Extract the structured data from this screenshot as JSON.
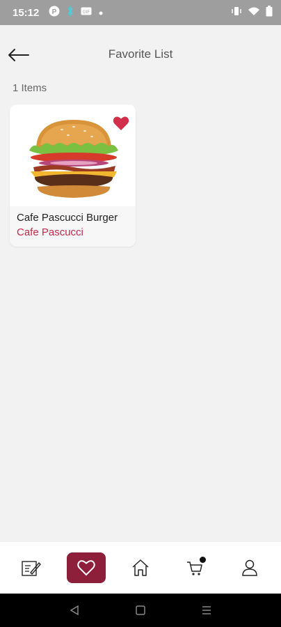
{
  "status_bar": {
    "time": "15:12",
    "icons": [
      "p-badge-icon",
      "bluetooth-icon",
      "gif-icon",
      "dot-icon",
      "vibrate-icon",
      "wifi-icon",
      "battery-icon"
    ]
  },
  "header": {
    "title": "Favorite List",
    "back_icon": "arrow-left-icon"
  },
  "favorites": {
    "count_label": "1 Items",
    "items": [
      {
        "name": "Cafe Pascucci Burger",
        "vendor": "Cafe Pascucci",
        "favorited": true
      }
    ]
  },
  "bottom_nav": {
    "items": [
      {
        "icon": "menu-edit-icon",
        "active": false
      },
      {
        "icon": "heart-icon",
        "active": true
      },
      {
        "icon": "home-icon",
        "active": false
      },
      {
        "icon": "cart-icon",
        "active": false,
        "badge": true
      },
      {
        "icon": "user-icon",
        "active": false
      }
    ]
  },
  "colors": {
    "accent": "#8e1f3a",
    "vendor": "#c8284a",
    "heart": "#d32f4a",
    "background": "#f2f2f2"
  }
}
